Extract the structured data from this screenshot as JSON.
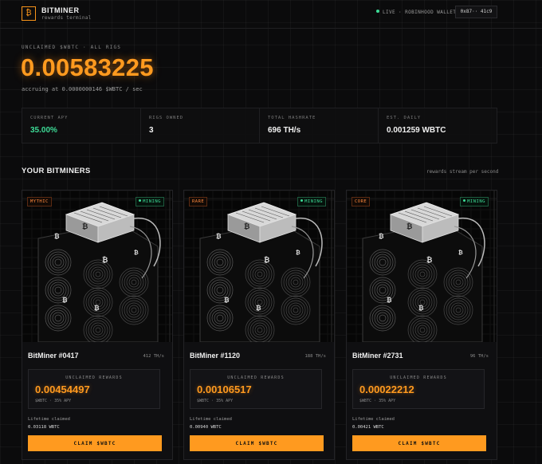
{
  "header": {
    "logo_glyph": "₿",
    "brand": "BITMINER",
    "subtitle": "rewards terminal",
    "live_label": "LIVE · ROBINHOOD WALLET",
    "wallet": "0x87·· 41c9",
    "live_color": "#3ddc97"
  },
  "hero": {
    "eyebrow": "UNCLAIMED $WBTC · ALL RIGS",
    "amount": "0.00583225",
    "accrual": "accruing at 0.0000000146 $WBTC / sec",
    "accent_color": "#ff9a1f"
  },
  "stats": [
    {
      "label": "CURRENT APY",
      "value": "35.00%"
    },
    {
      "label": "RIGS OWNED",
      "value": "3"
    },
    {
      "label": "TOTAL HASHRATE",
      "value": "696 TH/s"
    },
    {
      "label": "EST. DAILY",
      "value": "0.001259 WBTC"
    }
  ],
  "section": {
    "title": "YOUR BITMINERS",
    "note": "rewards stream per second"
  },
  "cards": [
    {
      "rarity": "MYTHIC",
      "status": "MINING",
      "name": "BitMiner #0417",
      "hashrate": "412 TH/s",
      "rewards_label": "UNCLAIMED REWARDS",
      "rewards": "0.00454497",
      "rewards_sub": "$WBTC · 35% APY",
      "lifetime_label": "Lifetime claimed",
      "lifetime": "0.03118 WBTC",
      "claim_label": "CLAIM $WBTC"
    },
    {
      "rarity": "RARE",
      "status": "MINING",
      "name": "BitMiner #1120",
      "hashrate": "188 TH/s",
      "rewards_label": "UNCLAIMED REWARDS",
      "rewards": "0.00106517",
      "rewards_sub": "$WBTC · 35% APY",
      "lifetime_label": "Lifetime claimed",
      "lifetime": "0.00940 WBTC",
      "claim_label": "CLAIM $WBTC"
    },
    {
      "rarity": "CORE",
      "status": "MINING",
      "name": "BitMiner #2731",
      "hashrate": "96 TH/s",
      "rewards_label": "UNCLAIMED REWARDS",
      "rewards": "0.00022212",
      "rewards_sub": "$WBTC · 35% APY",
      "lifetime_label": "Lifetime claimed",
      "lifetime": "0.00421 WBTC",
      "claim_label": "CLAIM $WBTC"
    }
  ]
}
